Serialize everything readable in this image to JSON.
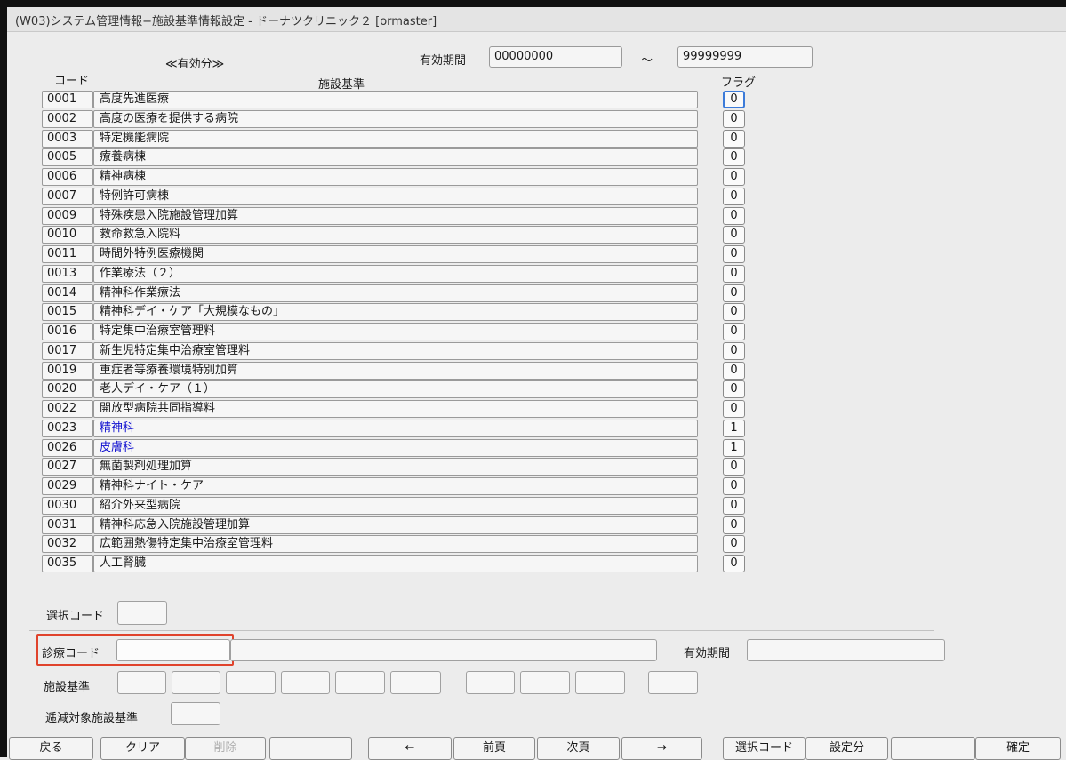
{
  "window": {
    "title": "(W03)システム管理情報−施設基準情報設定 - ドーナツクリニック２ [ormaster]"
  },
  "header": {
    "valid_label": "≪有効分≫",
    "period_label": "有効期間",
    "period_from": "00000000",
    "tilde": "～",
    "period_to": "99999999",
    "col_code": "コード",
    "col_name": "施設基準",
    "col_flag": "フラグ"
  },
  "rows": [
    {
      "code": "0001",
      "name": "高度先進医療",
      "flag": "0"
    },
    {
      "code": "0002",
      "name": "高度の医療を提供する病院",
      "flag": "0"
    },
    {
      "code": "0003",
      "name": "特定機能病院",
      "flag": "0"
    },
    {
      "code": "0005",
      "name": "療養病棟",
      "flag": "0"
    },
    {
      "code": "0006",
      "name": "精神病棟",
      "flag": "0"
    },
    {
      "code": "0007",
      "name": "特例許可病棟",
      "flag": "0"
    },
    {
      "code": "0009",
      "name": "特殊疾患入院施設管理加算",
      "flag": "0"
    },
    {
      "code": "0010",
      "name": "救命救急入院料",
      "flag": "0"
    },
    {
      "code": "0011",
      "name": "時間外特例医療機関",
      "flag": "0"
    },
    {
      "code": "0013",
      "name": "作業療法（２）",
      "flag": "0"
    },
    {
      "code": "0014",
      "name": "精神科作業療法",
      "flag": "0"
    },
    {
      "code": "0015",
      "name": "精神科デイ・ケア「大規模なもの」",
      "flag": "0"
    },
    {
      "code": "0016",
      "name": "特定集中治療室管理料",
      "flag": "0"
    },
    {
      "code": "0017",
      "name": "新生児特定集中治療室管理料",
      "flag": "0"
    },
    {
      "code": "0019",
      "name": "重症者等療養環境特別加算",
      "flag": "0"
    },
    {
      "code": "0020",
      "name": "老人デイ・ケア（１）",
      "flag": "0"
    },
    {
      "code": "0022",
      "name": "開放型病院共同指導料",
      "flag": "0"
    },
    {
      "code": "0023",
      "name": "精神科",
      "flag": "1"
    },
    {
      "code": "0026",
      "name": "皮膚科",
      "flag": "1"
    },
    {
      "code": "0027",
      "name": "無菌製剤処理加算",
      "flag": "0"
    },
    {
      "code": "0029",
      "name": "精神科ナイト・ケア",
      "flag": "0"
    },
    {
      "code": "0030",
      "name": "紹介外来型病院",
      "flag": "0"
    },
    {
      "code": "0031",
      "name": "精神科応急入院施設管理加算",
      "flag": "0"
    },
    {
      "code": "0032",
      "name": "広範囲熱傷特定集中治療室管理料",
      "flag": "0"
    },
    {
      "code": "0035",
      "name": "人工腎臓",
      "flag": "0"
    }
  ],
  "form": {
    "select_code_label": "選択コード",
    "select_code_value": "",
    "shinryo_code_label": "診療コード",
    "shinryo_code_value": "",
    "shinryo_name_value": "",
    "valid_period_label": "有効期間",
    "valid_period_value": "",
    "facility_std_label": "施設基準",
    "decrease_label": "逓減対象施設基準"
  },
  "buttons": [
    {
      "label": "戻る",
      "enabled": true
    },
    {
      "label": "クリア",
      "enabled": true
    },
    {
      "label": "削除",
      "enabled": false
    },
    {
      "label": "",
      "enabled": true
    },
    {
      "label": "←",
      "enabled": true
    },
    {
      "label": "前頁",
      "enabled": true
    },
    {
      "label": "次頁",
      "enabled": true
    },
    {
      "label": "→",
      "enabled": true
    },
    {
      "label": "選択コード",
      "enabled": true
    },
    {
      "label": "設定分",
      "enabled": true
    },
    {
      "label": "",
      "enabled": true
    },
    {
      "label": "確定",
      "enabled": true
    }
  ],
  "colors": {
    "highlight_border": "#e0432c",
    "focus_border": "#3c7bd9",
    "blue_text": "#1010d0"
  }
}
